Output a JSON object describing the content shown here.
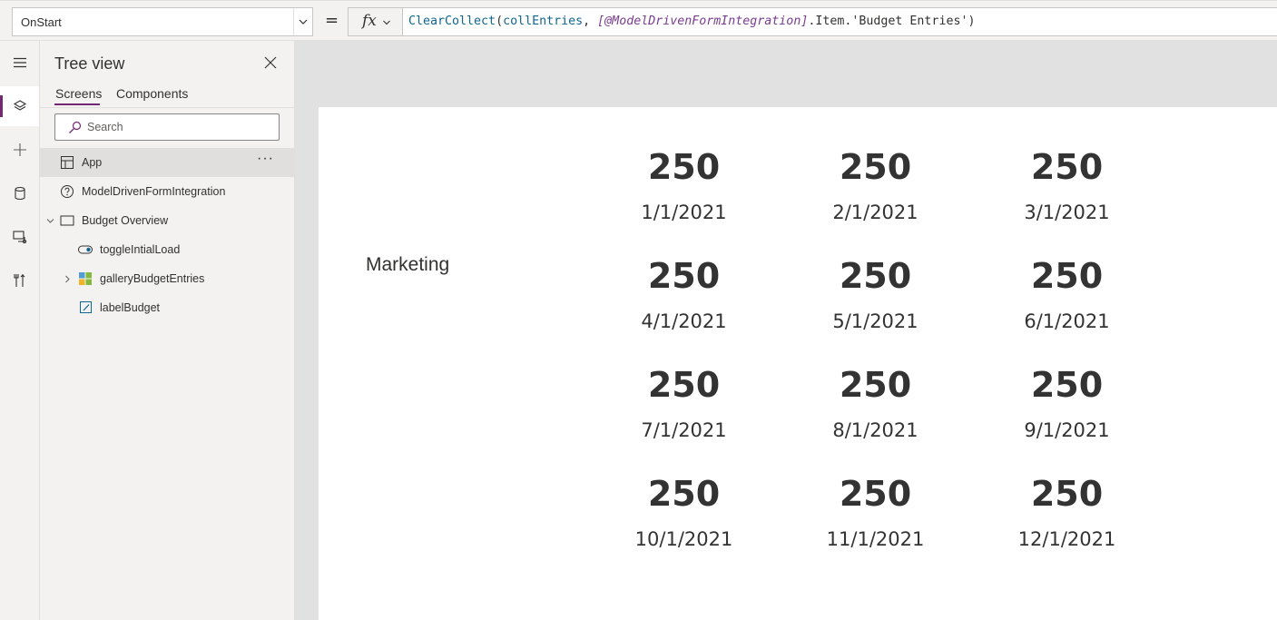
{
  "formula_bar": {
    "property": "OnStart",
    "equals": "=",
    "fx_label": "fx",
    "formula": {
      "fn": "ClearCollect",
      "open": "(",
      "arg1": "collEntries",
      "sep": ", ",
      "ref": "[@ModelDrivenFormIntegration]",
      "rest": ".Item.'Budget Entries')"
    }
  },
  "rail": {
    "items": [
      "hamburger-icon",
      "layers-icon",
      "plus-icon",
      "database-icon",
      "media-icon",
      "tools-icon"
    ]
  },
  "tree_view": {
    "title": "Tree view",
    "tabs": {
      "screens": "Screens",
      "components": "Components"
    },
    "search_placeholder": "Search",
    "nodes": [
      {
        "label": "App",
        "icon": "app-icon"
      },
      {
        "label": "ModelDrivenFormIntegration",
        "icon": "help-icon"
      },
      {
        "label": "Budget Overview",
        "icon": "screen-icon"
      },
      {
        "label": "toggleIntialLoad",
        "icon": "toggle-icon"
      },
      {
        "label": "galleryBudgetEntries",
        "icon": "gallery-icon"
      },
      {
        "label": "labelBudget",
        "icon": "label-icon"
      }
    ],
    "more": "···"
  },
  "screen": {
    "budget_label": "Marketing",
    "entries": [
      {
        "amount": "250",
        "date": "1/1/2021"
      },
      {
        "amount": "250",
        "date": "2/1/2021"
      },
      {
        "amount": "250",
        "date": "3/1/2021"
      },
      {
        "amount": "250",
        "date": "4/1/2021"
      },
      {
        "amount": "250",
        "date": "5/1/2021"
      },
      {
        "amount": "250",
        "date": "6/1/2021"
      },
      {
        "amount": "250",
        "date": "7/1/2021"
      },
      {
        "amount": "250",
        "date": "8/1/2021"
      },
      {
        "amount": "250",
        "date": "9/1/2021"
      },
      {
        "amount": "250",
        "date": "10/1/2021"
      },
      {
        "amount": "250",
        "date": "11/1/2021"
      },
      {
        "amount": "250",
        "date": "12/1/2021"
      }
    ]
  },
  "colors": {
    "accent": "#742774",
    "canvas": "#e1e1e1",
    "pane": "#f3f2f1"
  }
}
